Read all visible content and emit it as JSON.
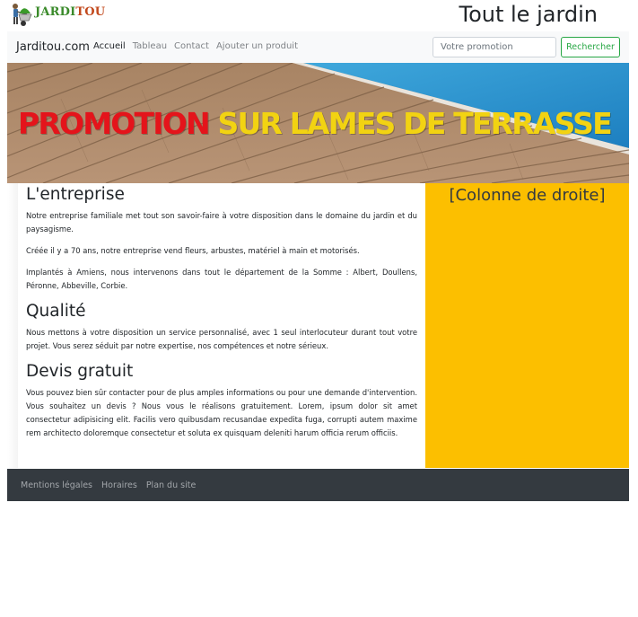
{
  "header": {
    "logo_part1": "JARDI",
    "logo_part2": "TOU",
    "title": "Tout le jardin"
  },
  "navbar": {
    "brand": "Jarditou.com",
    "links": [
      {
        "label": "Accueil",
        "active": true
      },
      {
        "label": "Tableau",
        "active": false
      },
      {
        "label": "Contact",
        "active": false
      },
      {
        "label": "Ajouter un produit",
        "active": false
      }
    ],
    "search_placeholder": "Votre promotion",
    "search_button": "Rechercher"
  },
  "banner": {
    "text_red": "PROMOTION",
    "text_yellow": "SUR LAMES DE TERRASSE"
  },
  "main": {
    "sections": [
      {
        "title": "L'entreprise",
        "paragraphs": [
          "Notre entreprise familiale met tout son savoir-faire à votre disposition dans le domaine du jardin et du paysagisme.",
          "Créée il y a 70 ans, notre entreprise vend fleurs, arbustes, matériel à main et motorisés.",
          "Implantés à Amiens, nous intervenons dans tout le département de la Somme : Albert, Doullens, Péronne, Abbeville, Corbie."
        ]
      },
      {
        "title": "Qualité",
        "paragraphs": [
          "Nous mettons à votre disposition un service personnalisé, avec 1 seul interlocuteur durant tout votre projet. Vous serez séduit par notre expertise, nos compétences et notre sérieux."
        ]
      },
      {
        "title": "Devis gratuit",
        "paragraphs": [
          "Vous pouvez bien sûr contacter pour de plus amples informations ou pour une demande d'intervention. Vous souhaitez un devis ? Nous vous le réalisons gratuitement. Lorem, ipsum dolor sit amet consectetur adipisicing elit. Facilis vero quibusdam recusandae expedita fuga, corrupti autem maxime rem architecto doloremque consectetur et soluta ex quisquam deleniti harum officia rerum officiis."
        ]
      }
    ]
  },
  "right_column": {
    "title": "[Colonne de droite]"
  },
  "footer": {
    "links": [
      "Mentions légales",
      "Horaires",
      "Plan du site"
    ]
  },
  "colors": {
    "navbar_bg": "#f8f9fa",
    "right_column_bg": "#fcbf00",
    "footer_bg": "#343a40",
    "search_button": "#28a745",
    "banner_red": "#e4141b",
    "banner_yellow": "#f2d312"
  }
}
